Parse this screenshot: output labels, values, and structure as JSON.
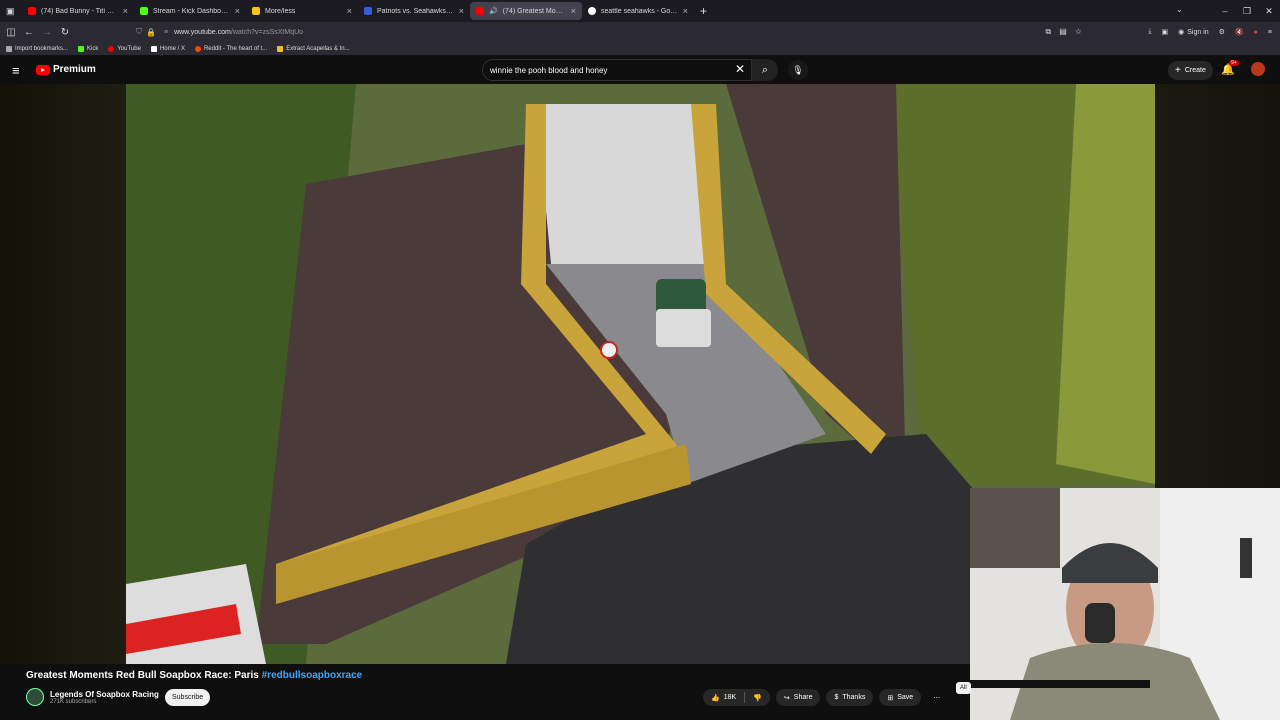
{
  "browser": {
    "tabs": [
      {
        "label": "(74) Bad Bunny - Tití Me Pregu",
        "color": "#ff0000"
      },
      {
        "label": "Stream - Kick Dashboard",
        "color": "#53fc18"
      },
      {
        "label": "More/less",
        "color": "#f5c518"
      },
      {
        "label": "Patriots vs. Seahawks Odds & P",
        "color": "#3b5bdb"
      },
      {
        "label": "(74) Greatest Moments Red",
        "color": "#ff0000"
      },
      {
        "label": "seattle seahawks - Google Sear",
        "color": "#ffffff"
      }
    ],
    "url_host": "www.youtube.com",
    "url_path": "/watch?v=zsSsXtMqUo",
    "sign_in": "Sign in",
    "bookmarks": [
      "Import bookmarks...",
      "Kick",
      "YouTube",
      "Home / X",
      "Reddit - The heart of t...",
      "Extract Acapellas & In..."
    ]
  },
  "youtube": {
    "brand": "Premium",
    "search_value": "winnie the pooh blood and honey",
    "create_label": "Create",
    "notif_count": "9+",
    "video_title_main": "Greatest Moments Red Bull Soapbox Race: Paris ",
    "video_title_tag": "#redbullsoapboxrace",
    "channel_name": "Legends Of Soapbox Racing",
    "subscribers": "271K subscribers",
    "subscribe_label": "Subscribe",
    "likes": "18K",
    "share_label": "Share",
    "thanks_label": "Thanks",
    "save_label": "Save",
    "all_chip": "All"
  },
  "colors": {
    "accent": "#ff0000",
    "link": "#3ea6ff"
  }
}
